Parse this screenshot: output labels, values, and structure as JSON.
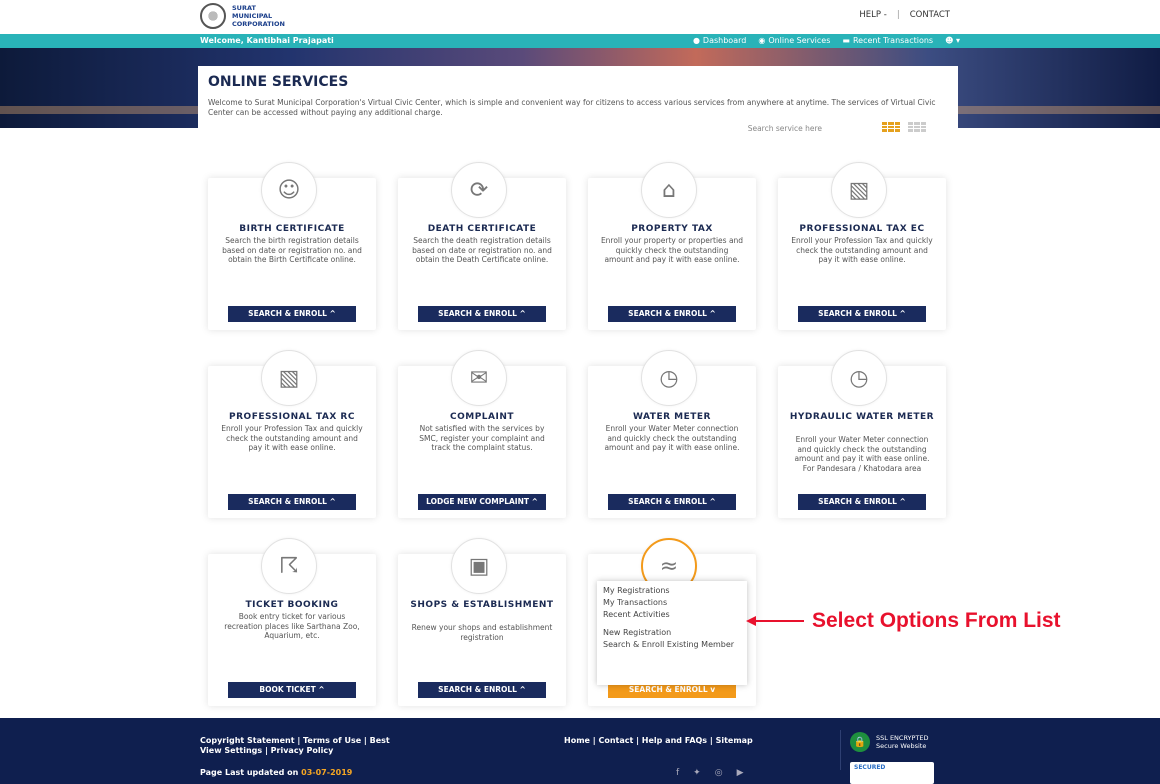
{
  "header": {
    "logo_lines": [
      "SURAT",
      "MUNICIPAL",
      "CORPORATION"
    ],
    "help": "HELP -",
    "sep": "|",
    "contact": "CONTACT"
  },
  "navbar": {
    "welcome": "Welcome, Kantibhai Prajapati",
    "dashboard": "Dashboard",
    "online_services": "Online Services",
    "recent_transactions": "Recent Transactions"
  },
  "intro": {
    "title": "ONLINE SERVICES",
    "text": "Welcome to Surat Municipal Corporation's Virtual Civic Center, which is simple and convenient way for citizens to access various services from anywhere at anytime. The services of Virtual Civic Center can be accessed without paying any additional charge.",
    "search_placeholder": "Search service here"
  },
  "cards": [
    {
      "title": "BIRTH CERTIFICATE",
      "desc": "Search the birth registration details based on date or registration no. and obtain the Birth Certificate online.",
      "button": "SEARCH & ENROLL ^"
    },
    {
      "title": "DEATH CERTIFICATE",
      "desc": "Search the death registration details based on date or registration no. and obtain the Death Certificate online.",
      "button": "SEARCH & ENROLL ^"
    },
    {
      "title": "PROPERTY TAX",
      "desc": "Enroll your property or properties and quickly check the outstanding amount and pay it with ease online.",
      "button": "SEARCH & ENROLL ^"
    },
    {
      "title": "PROFESSIONAL TAX EC",
      "desc": "Enroll your Profession Tax and quickly check the outstanding amount and pay it with ease online.",
      "button": "SEARCH & ENROLL ^"
    },
    {
      "title": "PROFESSIONAL TAX RC",
      "desc": "Enroll your Profession Tax and quickly check the outstanding amount and pay it with ease online.",
      "button": "SEARCH & ENROLL ^"
    },
    {
      "title": "COMPLAINT",
      "desc": "Not satisfied with the services by SMC, register your complaint and track the complaint status.",
      "button": "LODGE NEW COMPLAINT ^"
    },
    {
      "title": "WATER METER",
      "desc": "Enroll your Water Meter connection and quickly check the outstanding amount and pay it with ease online.",
      "button": "SEARCH & ENROLL ^"
    },
    {
      "title": "HYDRAULIC WATER METER",
      "desc": "Enroll your Water Meter connection and quickly check the outstanding amount and pay it with ease online. For Pandesara / Khatodara area",
      "button": "SEARCH & ENROLL ^"
    },
    {
      "title": "TICKET BOOKING",
      "desc": "Book entry ticket for various recreation places like Sarthana Zoo, Aquarium, etc.",
      "button": "BOOK TICKET ^"
    },
    {
      "title": "SHOPS & ESTABLISHMENT",
      "desc": "Renew your shops and establishment registration",
      "button": "SEARCH & ENROLL ^"
    },
    {
      "title": "",
      "desc": "",
      "button": "SEARCH & ENROLL v"
    }
  ],
  "dropdown": {
    "items": [
      "My Registrations",
      "My Transactions",
      "Recent Activities",
      "New Registration",
      "Search & Enroll Existing Member"
    ]
  },
  "annotation": {
    "text": "Select Options From List",
    "color": "#e8112d"
  },
  "footer": {
    "links_left": "Copyright Statement | Terms of Use | Best View Settings | Privacy Policy",
    "updated_label": "Page Last updated on",
    "updated_date": "03-07-2019",
    "links_right": "Home | Contact | Help and FAQs | Sitemap",
    "ssl_title": "SSL ENCRYPTED",
    "ssl_sub": "Secure Website",
    "badge_text": "SECURED"
  },
  "colors": {
    "teal": "#29b3b8",
    "navy": "#1a2b5e",
    "orange": "#f39a1a",
    "footer": "#0f1f4f"
  }
}
